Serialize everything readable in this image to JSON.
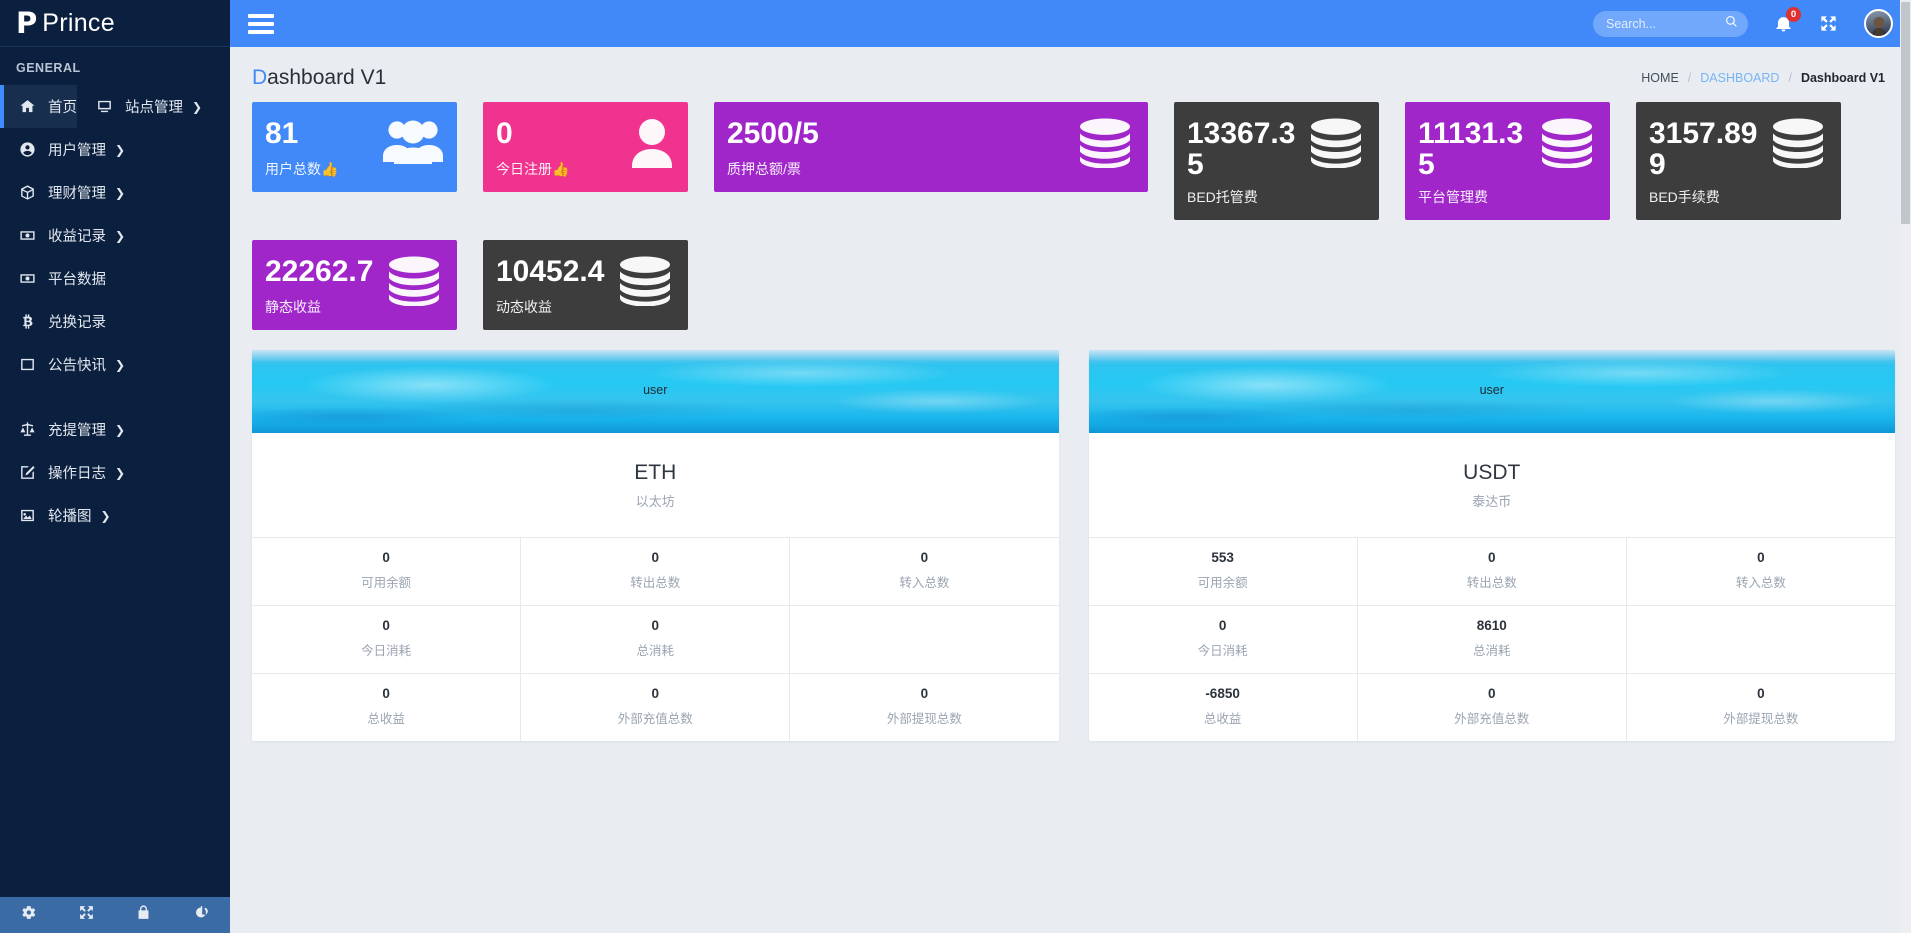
{
  "brand": {
    "logo_letter": "P",
    "name": "Prince"
  },
  "sidebar": {
    "section_label": "GENERAL",
    "items": [
      {
        "label": "首页",
        "icon": "home-icon",
        "caret": "",
        "active": true
      },
      {
        "label": "站点管理",
        "icon": "monitor-icon",
        "caret": "❯",
        "active": false
      },
      {
        "label": "用户管理",
        "icon": "user-circle-icon",
        "caret": "❯",
        "active": false
      },
      {
        "label": "理财管理",
        "icon": "box-icon",
        "caret": "❯",
        "active": false
      },
      {
        "label": "收益记录",
        "icon": "money-icon",
        "caret": "❯",
        "active": false
      },
      {
        "label": "平台数据",
        "icon": "money-icon",
        "caret": "",
        "active": false
      },
      {
        "label": "兑换记录",
        "icon": "bitcoin-icon",
        "caret": "",
        "active": false
      },
      {
        "label": "公告快讯",
        "icon": "window-icon",
        "caret": "❯",
        "active": false
      },
      {
        "label": "充提管理",
        "icon": "scales-icon",
        "caret": "❯",
        "active": false
      },
      {
        "label": "操作日志",
        "icon": "edit-icon",
        "caret": "❯",
        "active": false
      },
      {
        "label": "轮播图",
        "icon": "image-icon",
        "caret": "❯",
        "active": false
      }
    ],
    "footer_icons": [
      "gear-icon",
      "expand-icon",
      "lock-icon",
      "power-icon"
    ]
  },
  "topbar": {
    "menu_toggle": "hamburger-icon",
    "search": {
      "value": "",
      "placeholder": "Search..."
    },
    "notification_count": "0",
    "fullscreen_icon": "expand-icon",
    "avatar": "user-avatar"
  },
  "page": {
    "title_first": "D",
    "title_rest": "ashboard V1",
    "breadcrumb": {
      "home": "HOME",
      "section": "DASHBOARD",
      "current": "Dashboard V1",
      "separator": "/"
    }
  },
  "colors": {
    "blue": "#4189f9",
    "pink": "#f0338f",
    "purple": "#a026c9",
    "dark": "#3d3d3d",
    "sidebar": "#0b1f3f",
    "badge_red": "#e03131"
  },
  "stat_cards": [
    {
      "value": "81",
      "label": "用户总数👍",
      "color": "blue",
      "icon": "users-icon",
      "width_class": "w-blue"
    },
    {
      "value": "0",
      "label": "今日注册👍",
      "color": "pink",
      "icon": "person-icon",
      "width_class": "w-pink"
    },
    {
      "value": "2500/5",
      "label": "质押总额/票",
      "color": "purple",
      "icon": "database-icon",
      "width_class": "w-purple"
    },
    {
      "value": "13367.35",
      "label": "BED托管费",
      "color": "dark",
      "icon": "database-icon",
      "width_class": "w-dark1"
    },
    {
      "value": "11131.35",
      "label": "平台管理费",
      "color": "purple",
      "icon": "database-icon",
      "width_class": "w-mag"
    },
    {
      "value": "3157.899",
      "label": "BED手续费",
      "color": "dark",
      "icon": "database-icon",
      "width_class": "w-d2"
    },
    {
      "value": "22262.7",
      "label": "静态收益",
      "color": "purple",
      "icon": "database-icon",
      "width_class": "w-p2"
    },
    {
      "value": "10452.4",
      "label": "动态收益",
      "color": "dark",
      "icon": "database-icon",
      "width_class": "w-d3"
    }
  ],
  "coin_panels": [
    {
      "user_label": "user",
      "symbol": "ETH",
      "name": "以太坊",
      "rows": [
        [
          {
            "value": "0",
            "label": "可用余额"
          },
          {
            "value": "0",
            "label": "转出总数"
          },
          {
            "value": "0",
            "label": "转入总数"
          }
        ],
        [
          {
            "value": "0",
            "label": "今日消耗"
          },
          {
            "value": "0",
            "label": "总消耗"
          },
          {
            "value": "",
            "label": ""
          }
        ],
        [
          {
            "value": "0",
            "label": "总收益"
          },
          {
            "value": "0",
            "label": "外部充值总数"
          },
          {
            "value": "0",
            "label": "外部提现总数"
          }
        ]
      ]
    },
    {
      "user_label": "user",
      "symbol": "USDT",
      "name": "泰达币",
      "rows": [
        [
          {
            "value": "553",
            "label": "可用余额"
          },
          {
            "value": "0",
            "label": "转出总数"
          },
          {
            "value": "0",
            "label": "转入总数"
          }
        ],
        [
          {
            "value": "0",
            "label": "今日消耗"
          },
          {
            "value": "8610",
            "label": "总消耗"
          },
          {
            "value": "",
            "label": ""
          }
        ],
        [
          {
            "value": "-6850",
            "label": "总收益"
          },
          {
            "value": "0",
            "label": "外部充值总数"
          },
          {
            "value": "0",
            "label": "外部提现总数"
          }
        ]
      ]
    }
  ]
}
